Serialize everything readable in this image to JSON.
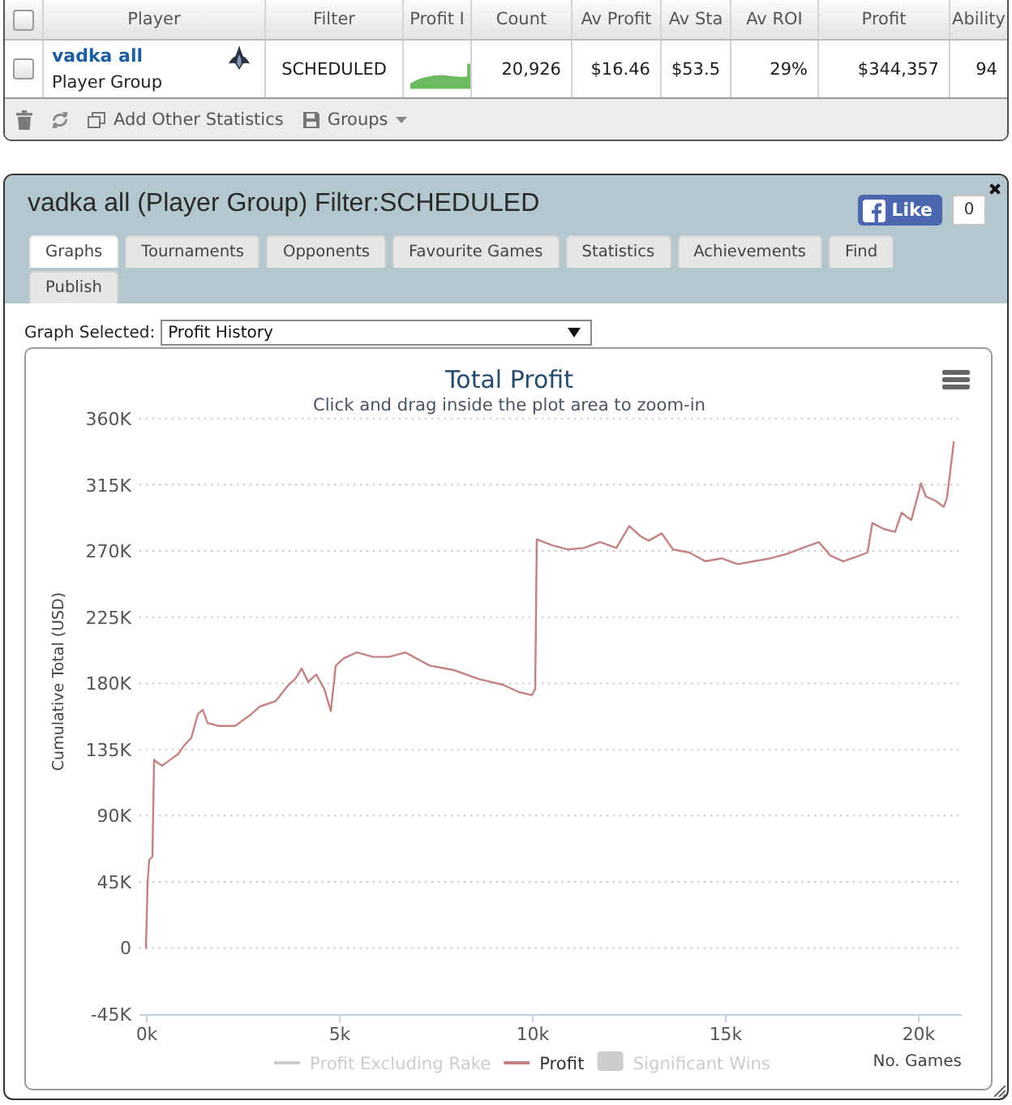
{
  "table": {
    "select_all": {
      "checked": false
    },
    "columns": [
      "Player",
      "Filter",
      "Profit I",
      "Count",
      "Av Profit",
      "Av Sta",
      "Av ROI",
      "Profit",
      "Ability"
    ],
    "rows": [
      {
        "checked": false,
        "cells": [
          {
            "kind": "player",
            "text": "vadka all",
            "subtext": "Player Group"
          },
          {
            "kind": "text",
            "text": "SCHEDULED"
          },
          {
            "kind": "sparkline"
          },
          {
            "kind": "text",
            "text": "20,926"
          },
          {
            "kind": "text",
            "text": "$16.46"
          },
          {
            "kind": "text",
            "text": "$53.5"
          },
          {
            "kind": "text",
            "text": "29%"
          },
          {
            "kind": "text",
            "text": "$344,357"
          },
          {
            "kind": "text",
            "text": "94"
          }
        ]
      }
    ]
  },
  "toolbar": {
    "add_statistics": "Add Other Statistics",
    "groups": "Groups"
  },
  "panel": {
    "title": "vadka all (Player Group) Filter:SCHEDULED",
    "like": {
      "label": "Like",
      "count": "0"
    },
    "tabs": [
      {
        "label": "Graphs",
        "selected": true
      },
      {
        "label": "Tournaments",
        "selected": false
      },
      {
        "label": "Opponents",
        "selected": false
      },
      {
        "label": "Favourite Games",
        "selected": false
      },
      {
        "label": "Statistics",
        "selected": false
      },
      {
        "label": "Achievements",
        "selected": false
      },
      {
        "label": "Find",
        "selected": false
      },
      {
        "label": "Publish",
        "selected": false
      }
    ],
    "graph_select": {
      "label": "Graph Selected:",
      "value": "Profit History"
    },
    "chart": {
      "subtitle": "Click and drag inside the plot area to zoom-in",
      "legend": [
        {
          "kind": "line",
          "label": "Profit Excluding Rake",
          "visible": false
        },
        {
          "kind": "series",
          "visible": true
        },
        {
          "kind": "area",
          "label": "Significant Wins",
          "visible": false
        }
      ],
      "chart_data": {
        "type": "line",
        "title": "Total Profit",
        "xlabel": "No. Games",
        "ylabel": "Cumulative Total (USD)",
        "grid": true,
        "xlim": [
          -170,
          21130
        ],
        "ylim": [
          -45000,
          360000
        ],
        "xticks": [
          {
            "value": 0,
            "label": "0k"
          },
          {
            "value": 5000,
            "label": "5k"
          },
          {
            "value": 10000,
            "label": "10k"
          },
          {
            "value": 15000,
            "label": "15k"
          },
          {
            "value": 20000,
            "label": "20k"
          }
        ],
        "yticks": [
          {
            "value": -45000,
            "label": "-45K"
          },
          {
            "value": 0,
            "label": "0"
          },
          {
            "value": 45000,
            "label": "45K"
          },
          {
            "value": 90000,
            "label": "90K"
          },
          {
            "value": 135000,
            "label": "135K"
          },
          {
            "value": 180000,
            "label": "180K"
          },
          {
            "value": 225000,
            "label": "225K"
          },
          {
            "value": 270000,
            "label": "270K"
          },
          {
            "value": 315000,
            "label": "315K"
          },
          {
            "value": 360000,
            "label": "360K"
          }
        ],
        "x": [
          0,
          42,
          84,
          168,
          210,
          294,
          420,
          630,
          840,
          966,
          1176,
          1344,
          1470,
          1596,
          1890,
          2310,
          2730,
          2940,
          3360,
          3696,
          3864,
          4032,
          4200,
          4410,
          4620,
          4788,
          4914,
          5124,
          5460,
          5880,
          6300,
          6720,
          7350,
          7980,
          8610,
          9240,
          9660,
          9996,
          10080,
          10122,
          10500,
          10920,
          11340,
          11760,
          12180,
          12516,
          12810,
          13020,
          13356,
          13650,
          14070,
          14490,
          14910,
          15330,
          15750,
          16170,
          16590,
          17010,
          17430,
          17724,
          18060,
          18396,
          18690,
          18816,
          19110,
          19404,
          19572,
          19824,
          20076,
          20202,
          20454,
          20664,
          20748,
          20926
        ],
        "series": [
          {
            "name": "Profit",
            "color": "#c38383",
            "values": [
              0,
              44000,
              60000,
              62000,
              128000,
              126000,
              124000,
              128000,
              132000,
              137000,
              143000,
              159000,
              162000,
              153000,
              151000,
              151000,
              159000,
              164000,
              168000,
              179000,
              183000,
              190000,
              181000,
              186000,
              176000,
              161000,
              192000,
              197000,
              201000,
              198000,
              198000,
              201000,
              192000,
              189000,
              183000,
              179000,
              174000,
              172000,
              176000,
              278000,
              274000,
              271000,
              272000,
              276000,
              272000,
              287000,
              280000,
              277000,
              282000,
              271000,
              269000,
              263000,
              265000,
              261000,
              263000,
              265000,
              268000,
              272000,
              276000,
              267000,
              263000,
              266000,
              269000,
              289000,
              285000,
              283000,
              296000,
              291000,
              316000,
              307000,
              304000,
              300000,
              306000,
              344000
            ]
          }
        ]
      }
    }
  }
}
